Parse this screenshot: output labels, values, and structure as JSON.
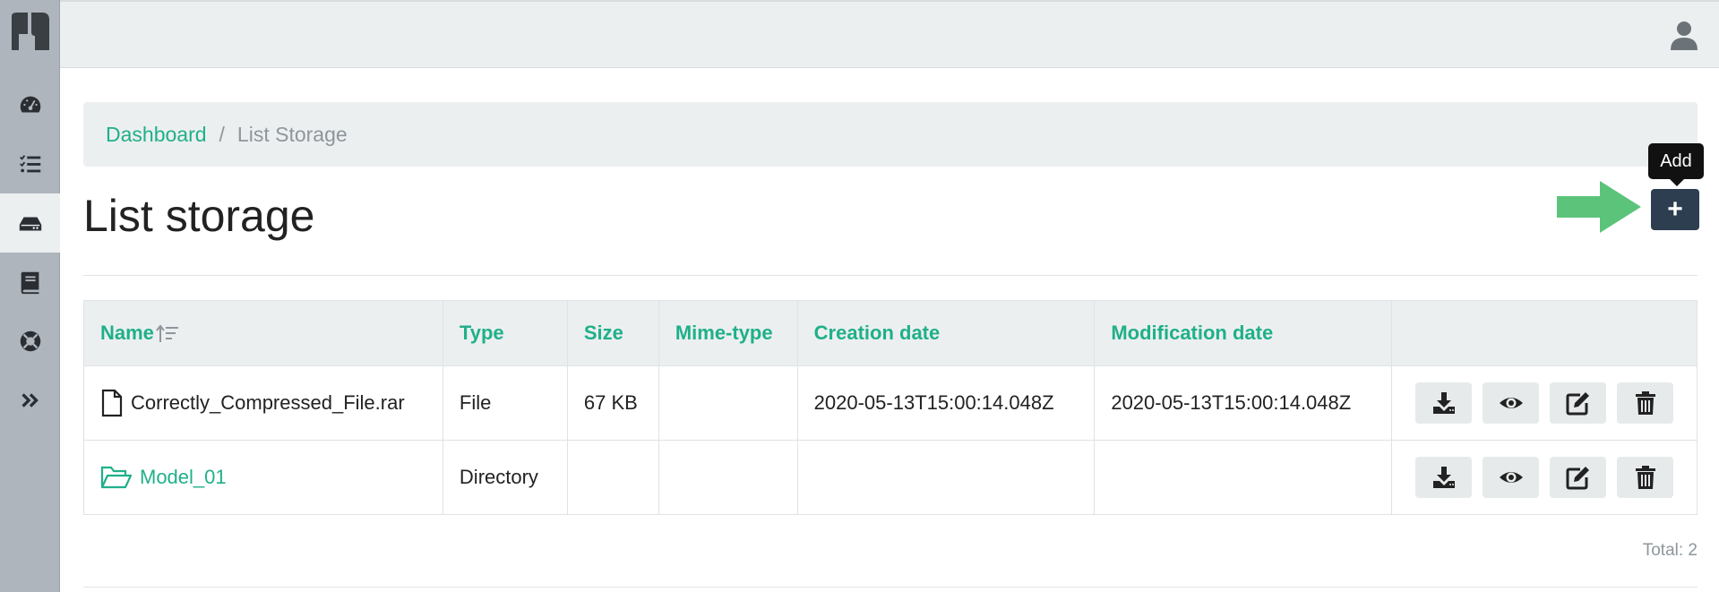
{
  "sidebar": {
    "items": [
      {
        "icon": "dashboard-gauge-icon",
        "active": false
      },
      {
        "icon": "task-list-icon",
        "active": false
      },
      {
        "icon": "storage-drive-icon",
        "active": true
      },
      {
        "icon": "book-icon",
        "active": false
      },
      {
        "icon": "life-ring-icon",
        "active": false
      },
      {
        "icon": "double-chevron-right-icon",
        "active": false
      }
    ]
  },
  "breadcrumb": {
    "home": "Dashboard",
    "separator": "/",
    "current": "List Storage"
  },
  "page": {
    "title": "List storage",
    "add_tooltip": "Add",
    "add_label": "+",
    "total": "Total: 2"
  },
  "table": {
    "columns": [
      "Name",
      "Type",
      "Size",
      "Mime-type",
      "Creation date",
      "Modification date",
      ""
    ],
    "rows": [
      {
        "name": "Correctly_Compressed_File.rar",
        "kind": "file",
        "type": "File",
        "size": "67 KB",
        "mime": "",
        "created": "2020-05-13T15:00:14.048Z",
        "modified": "2020-05-13T15:00:14.048Z"
      },
      {
        "name": "Model_01",
        "kind": "directory",
        "type": "Directory",
        "size": "",
        "mime": "",
        "created": "",
        "modified": ""
      }
    ]
  },
  "colors": {
    "accent": "#1fb08a",
    "sidebar": "#aeb5bc",
    "add_button": "#2c3e50",
    "arrow": "#5cc47a"
  }
}
